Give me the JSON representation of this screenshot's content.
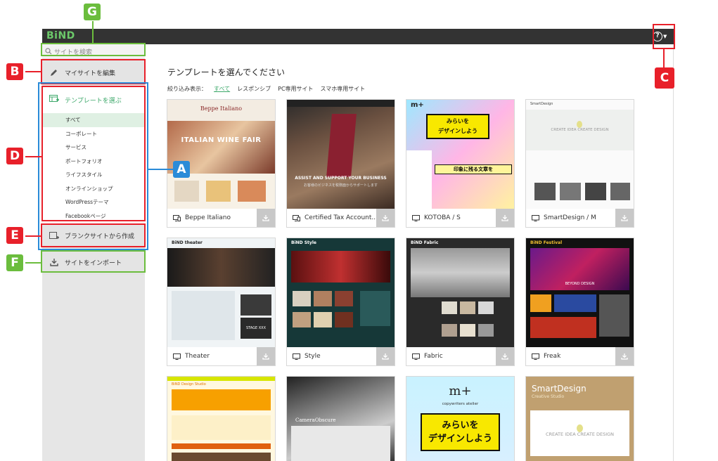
{
  "app": {
    "logo": "BiND"
  },
  "search": {
    "placeholder": "サイトを検索"
  },
  "sidebar": {
    "edit_label": "マイサイトを編集",
    "template_label": "テンプレートを選ぶ",
    "categories": [
      "すべて",
      "コーポレート",
      "サービス",
      "ポートフォリオ",
      "ライフスタイル",
      "オンラインショップ",
      "WordPressテーマ",
      "Facebookページ"
    ],
    "blank_label": "ブランクサイトから作成",
    "import_label": "サイトをインポート"
  },
  "main": {
    "title": "テンプレートを選んでください",
    "filter_label": "絞り込み表示：",
    "filters": [
      "すべて",
      "レスポンシブ",
      "PC専用サイト",
      "スマホ専用サイト"
    ]
  },
  "templates": [
    {
      "name": "Beppe Italiano",
      "thumb_text": "ITALIAN WINE FAIR",
      "thumb_sub": "Beppe Italiano"
    },
    {
      "name": "Certified Tax Account...",
      "thumb_text": "ASSIST AND SUPPORT YOUR BUSINESS",
      "thumb_sub": "お客様のビジネスを税務面からサポートします"
    },
    {
      "name": "KOTOBA / S",
      "thumb_text": "みらいを\nデザインしよう",
      "thumb_sub": "印象に残る文章を",
      "thumb_logo": "m+"
    },
    {
      "name": "SmartDesign / M",
      "thumb_text": "CREATE IDEA   CREATE DESIGN",
      "thumb_sub": "SmartDesign"
    },
    {
      "name": "Theater",
      "thumb_text": "BiND theater",
      "thumb_sub": "STAGE XXX"
    },
    {
      "name": "Style",
      "thumb_text": "BiND Style"
    },
    {
      "name": "Fabric",
      "thumb_text": "BiND Fabric"
    },
    {
      "name": "Freak",
      "thumb_text": "BiND Festival",
      "thumb_sub": "BEYOND DESIGN"
    },
    {
      "name": "",
      "thumb_text": "BiND Design Studio"
    },
    {
      "name": "",
      "thumb_text": "CameraObscure"
    },
    {
      "name": "",
      "thumb_text": "みらいを\nデザインしよう",
      "thumb_logo": "m+",
      "thumb_sub": "copywriters atelier"
    },
    {
      "name": "",
      "thumb_text": "CREATE IDEA   CREATE DESIGN",
      "thumb_sub": "SmartDesign",
      "thumb_sub2": "Creative Studio"
    }
  ],
  "markers": [
    "G",
    "B",
    "C",
    "D",
    "A",
    "E",
    "F"
  ],
  "colors": {
    "red": "#e8202a",
    "green": "#6bbd3d",
    "blue": "#2a8bd8",
    "accent": "#3ca86a"
  }
}
